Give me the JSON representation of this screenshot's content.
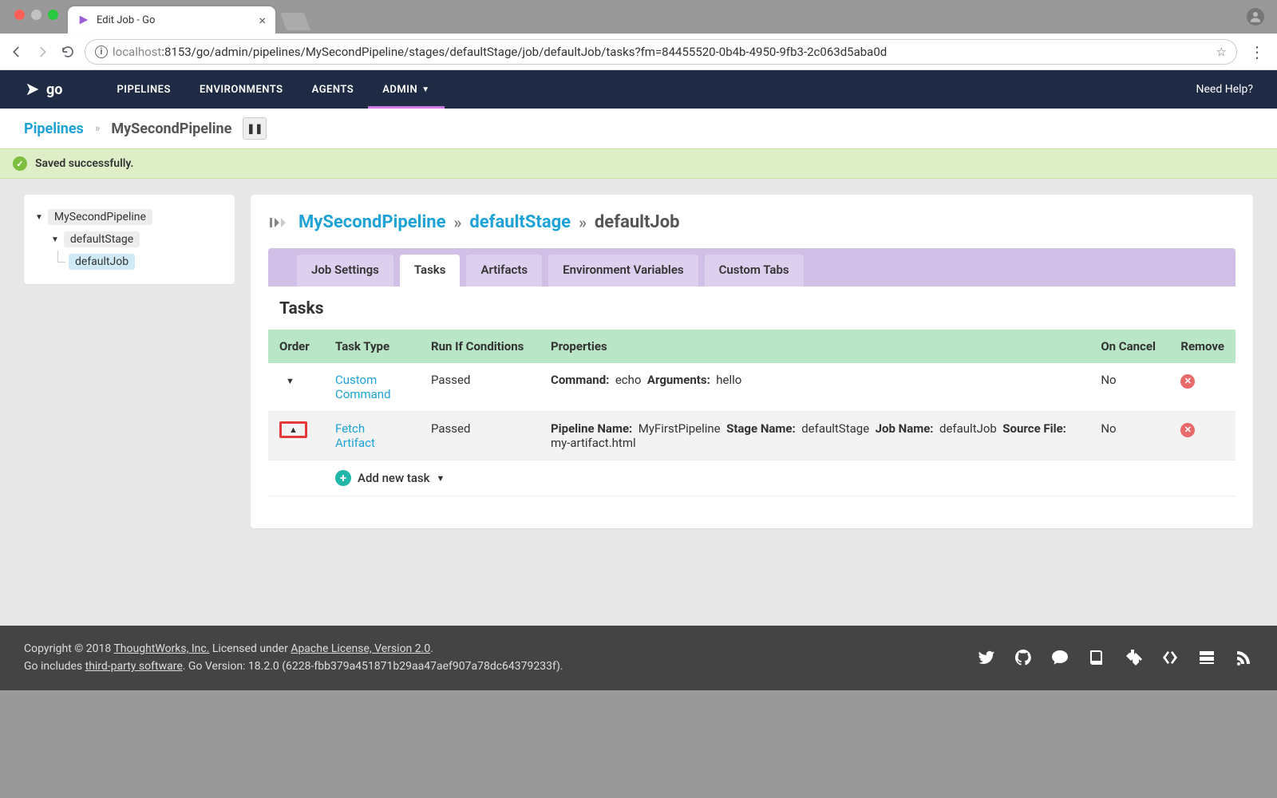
{
  "browser": {
    "tab_title": "Edit Job - Go",
    "url_host_dim": "localhost",
    "url_rest": ":8153/go/admin/pipelines/MySecondPipeline/stages/defaultStage/job/defaultJob/tasks?fm=84455520-0b4b-4950-9fb3-2c063d5aba0d"
  },
  "topnav": {
    "logo_text": "go",
    "items": [
      "PIPELINES",
      "ENVIRONMENTS",
      "AGENTS",
      "ADMIN"
    ],
    "active_index": 3,
    "need_help": "Need Help?"
  },
  "subbar": {
    "link": "Pipelines",
    "current": "MySecondPipeline"
  },
  "flash": {
    "message": "Saved successfully."
  },
  "tree": {
    "pipeline": "MySecondPipeline",
    "stage": "defaultStage",
    "job": "defaultJob"
  },
  "crumb": {
    "pipeline": "MySecondPipeline",
    "stage": "defaultStage",
    "job": "defaultJob"
  },
  "tabs": {
    "items": [
      "Job Settings",
      "Tasks",
      "Artifacts",
      "Environment Variables",
      "Custom Tabs"
    ],
    "active_index": 1
  },
  "section_title": "Tasks",
  "table": {
    "headers": {
      "order": "Order",
      "type": "Task Type",
      "runif": "Run If Conditions",
      "props": "Properties",
      "oncancel": "On Cancel",
      "remove": "Remove"
    },
    "rows": [
      {
        "type": "Custom Command",
        "runif": "Passed",
        "props_pairs": [
          [
            "Command:",
            "echo"
          ],
          [
            "Arguments:",
            "hello"
          ]
        ],
        "oncancel": "No"
      },
      {
        "type": "Fetch Artifact",
        "runif": "Passed",
        "props_pairs": [
          [
            "Pipeline Name:",
            "MyFirstPipeline"
          ],
          [
            "Stage Name:",
            "defaultStage"
          ],
          [
            "Job Name:",
            "defaultJob"
          ],
          [
            "Source File:",
            "my-artifact.html"
          ]
        ],
        "oncancel": "No"
      }
    ],
    "add_label": "Add new task"
  },
  "footer": {
    "line1_pre": "Copyright © 2018 ",
    "line1_link": "ThoughtWorks, Inc.",
    "line1_mid": " Licensed under ",
    "line1_link2": "Apache License, Version 2.0",
    "line1_post": ".",
    "line2_pre": "Go includes ",
    "line2_link": "third-party software",
    "line2_post": ". Go Version: 18.2.0 (6228-fbb379a451871b29aa47aef907a78dc64379233f)."
  }
}
